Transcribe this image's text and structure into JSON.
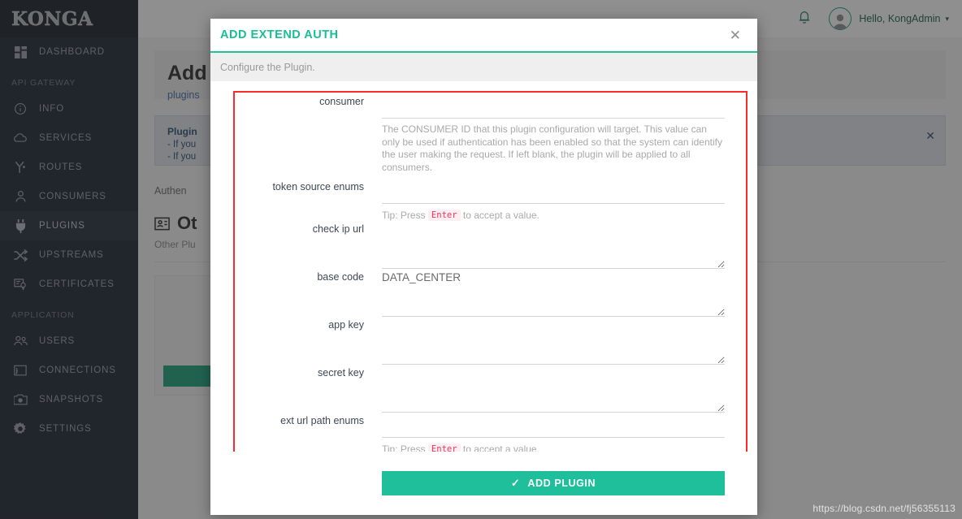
{
  "brand": {
    "name": "KONGA"
  },
  "sidebar": {
    "top_items": [
      {
        "label": "DASHBOARD",
        "icon": "dashboard-icon",
        "active": false
      }
    ],
    "sections": [
      {
        "label": "API GATEWAY",
        "items": [
          {
            "label": "INFO",
            "icon": "info-icon",
            "active": false
          },
          {
            "label": "SERVICES",
            "icon": "cloud-icon",
            "active": false
          },
          {
            "label": "ROUTES",
            "icon": "routes-icon",
            "active": false
          },
          {
            "label": "CONSUMERS",
            "icon": "user-icon",
            "active": false
          },
          {
            "label": "PLUGINS",
            "icon": "plug-icon",
            "active": true
          },
          {
            "label": "UPSTREAMS",
            "icon": "shuffle-icon",
            "active": false
          },
          {
            "label": "CERTIFICATES",
            "icon": "certificate-icon",
            "active": false
          }
        ]
      },
      {
        "label": "APPLICATION",
        "items": [
          {
            "label": "USERS",
            "icon": "users-icon",
            "active": false
          },
          {
            "label": "CONNECTIONS",
            "icon": "connections-icon",
            "active": false
          },
          {
            "label": "SNAPSHOTS",
            "icon": "camera-icon",
            "active": false
          },
          {
            "label": "SETTINGS",
            "icon": "gear-icon",
            "active": false
          }
        ]
      }
    ]
  },
  "topbar": {
    "bell_icon": "bell-icon",
    "avatar_icon": "avatar-icon",
    "greeting": "Hello, KongAdmin",
    "caret": "▾"
  },
  "page": {
    "title": "Add",
    "subtitle": "plugins",
    "info": {
      "title": "Plugin",
      "line1": "- If you",
      "line2": "- If you",
      "close_icon": "close-icon"
    },
    "auth_note": "Authen",
    "other_title": "Ot",
    "other_icon": "card-icon",
    "other_sub": "Other Plu"
  },
  "modal": {
    "title": "ADD EXTEND AUTH",
    "close_icon": "close-icon",
    "subtitle": "Configure the Plugin.",
    "fields": [
      {
        "label": "consumer",
        "type": "input",
        "value": "",
        "help": "The CONSUMER ID that this plugin configuration will target. This value can only be used if authentication has been enabled so that the system can identify the user making the request. If left blank, the plugin will be applied to all consumers."
      },
      {
        "label": "token source enums",
        "type": "input",
        "value": "",
        "tip_prefix": "Tip: Press",
        "tip_key": "Enter",
        "tip_suffix": "to accept a value."
      },
      {
        "label": "check ip url",
        "type": "textarea",
        "value": ""
      },
      {
        "label": "base code",
        "type": "textarea",
        "value": "DATA_CENTER"
      },
      {
        "label": "app key",
        "type": "textarea",
        "value": ""
      },
      {
        "label": "secret key",
        "type": "textarea",
        "value": ""
      },
      {
        "label": "ext url path enums",
        "type": "input",
        "value": "",
        "tip_prefix": "Tip: Press",
        "tip_key": "Enter",
        "tip_suffix": "to accept a value."
      }
    ],
    "submit": {
      "label": "ADD PLUGIN",
      "icon": "check-icon"
    }
  },
  "watermark": "https://blog.csdn.net/fj56355113",
  "colors": {
    "accent_teal": "#1ebf9a",
    "sidebar_bg": "#1b2430",
    "highlight_red": "#fc2b2b",
    "kbd_pink": "#e8365e"
  }
}
